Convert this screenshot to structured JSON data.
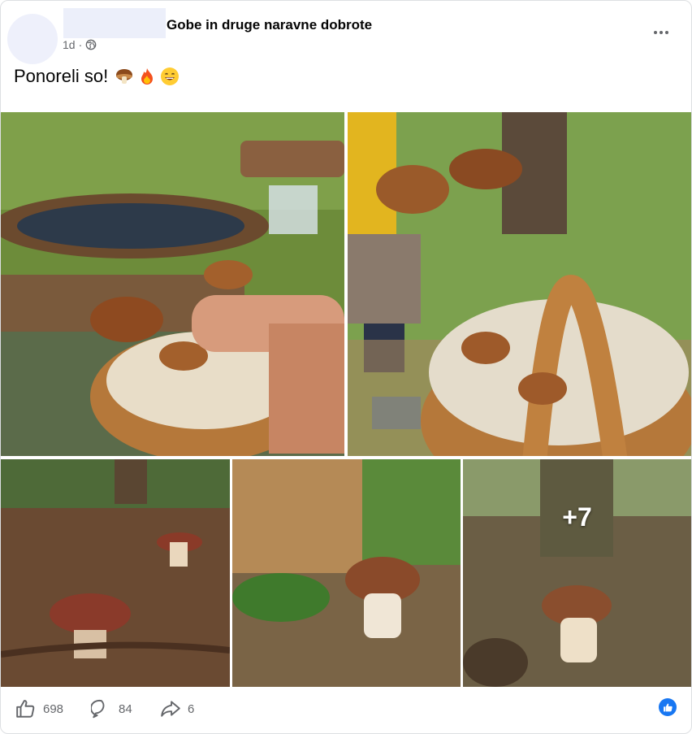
{
  "post": {
    "group_name": "Gobe in druge naravne dobrote",
    "time": "1d",
    "separator": "·",
    "text": "Ponoreli so!",
    "emojis": [
      "mushroom-emoji",
      "fire-emoji",
      "grinning-emoji"
    ]
  },
  "photos": {
    "more_count": "+7",
    "descriptions": [
      "grid-photo-1",
      "grid-photo-2",
      "grid-photo-3",
      "grid-photo-4",
      "grid-photo-5"
    ]
  },
  "stats": {
    "likes": "698",
    "comments": "84",
    "shares": "6"
  },
  "icons": {
    "privacy": "globe-icon",
    "menu": "more-options-icon",
    "like": "thumbs-up-icon",
    "comment": "comment-bubble-icon",
    "share": "share-arrow-icon",
    "reaction": "like-reaction-icon"
  },
  "colors": {
    "accent": "#1877f2",
    "secondary_text": "#65676b"
  }
}
